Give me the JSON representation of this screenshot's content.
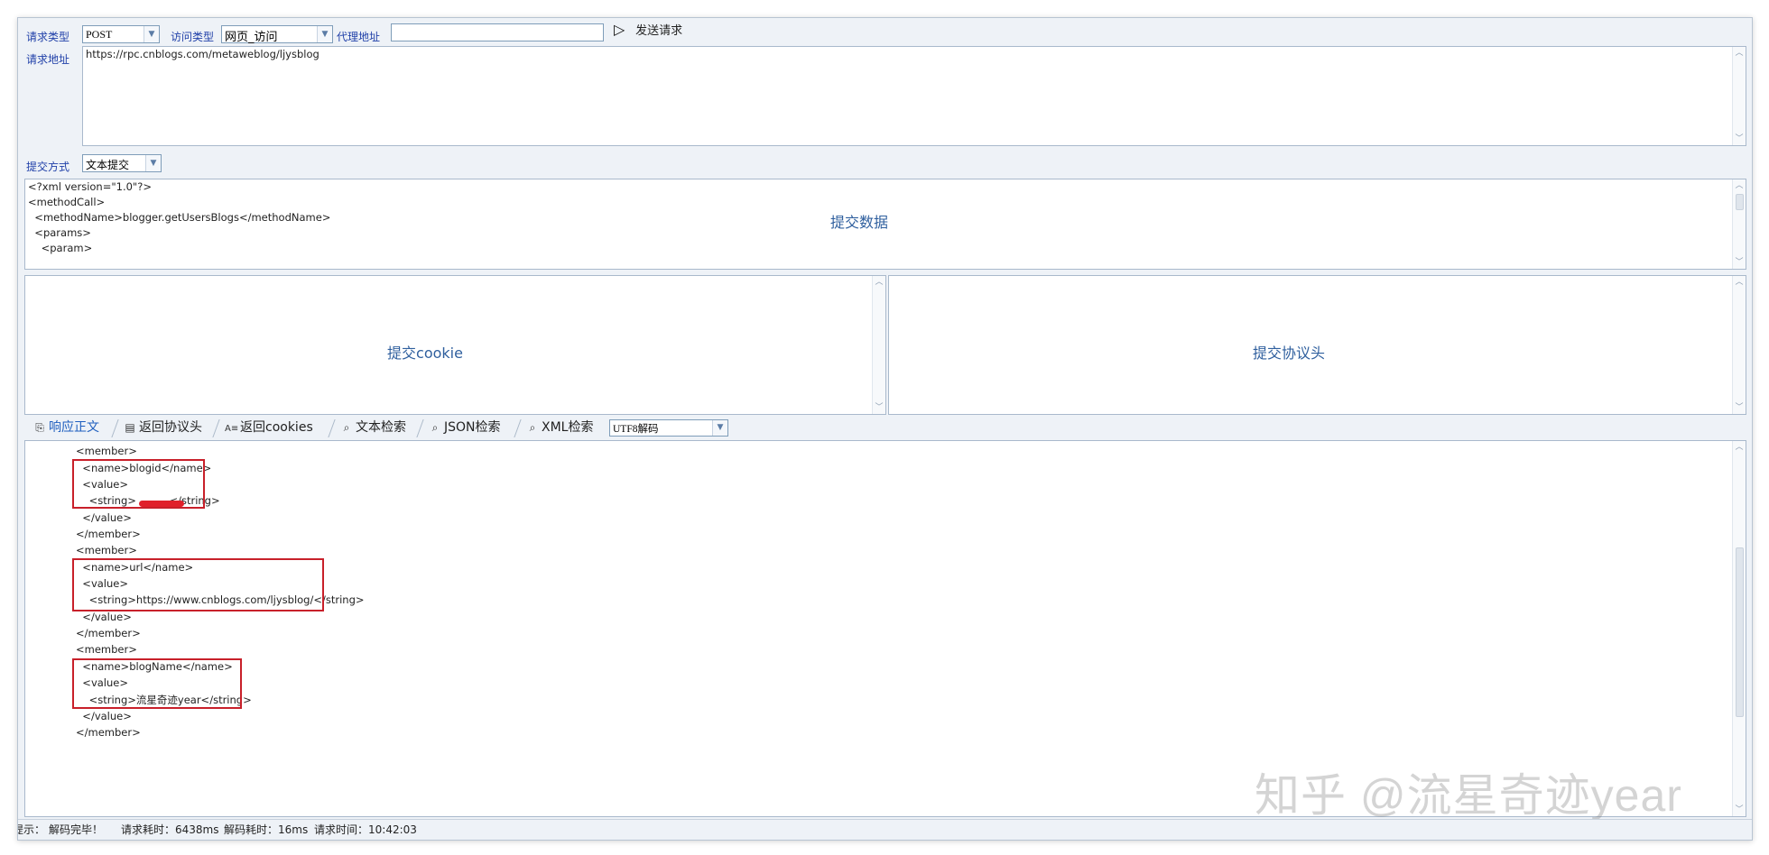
{
  "toolbar": {
    "request_type_label": "请求类型",
    "request_type_value": "POST",
    "access_type_label": "访问类型",
    "access_type_value": "网页_访问",
    "proxy_label": "代理地址",
    "proxy_value": "",
    "send_label": "发送请求"
  },
  "url_section": {
    "label": "请求地址",
    "value": "https://rpc.cnblogs.com/metaweblog/ljysblog"
  },
  "submit_section": {
    "label": "提交方式",
    "mode_value": "文本提交",
    "data_placeholder": "提交数据",
    "data_lines": [
      "<?xml version=\"1.0\"?>",
      "<methodCall>",
      "  <methodName>blogger.getUsersBlogs</methodName>",
      "  <params>",
      "    <param>"
    ],
    "cookie_placeholder": "提交cookie",
    "headers_placeholder": "提交协议头"
  },
  "response_tabs": {
    "tabs": [
      {
        "label": "响应正文",
        "icon": "response-icon"
      },
      {
        "label": "返回协议头",
        "icon": "document-icon"
      },
      {
        "label": "返回cookies",
        "icon": "cookie-text-icon"
      },
      {
        "label": "文本检索",
        "icon": "search-icon"
      },
      {
        "label": "JSON检索",
        "icon": "search-icon"
      },
      {
        "label": "XML检索",
        "icon": "search-icon"
      }
    ],
    "decode_value": "UTF8解码"
  },
  "response_body": {
    "lines": [
      "<member>",
      "  <name>blogid</name>",
      "  <value>",
      "    <string>          </string>",
      "  </value>",
      "</member>",
      "<member>",
      "  <name>url</name>",
      "  <value>",
      "    <string>https://www.cnblogs.com/ljysblog/</string>",
      "  </value>",
      "</member>",
      "<member>",
      "  <name>blogName</name>",
      "  <value>",
      "    <string>流星奇迹year</string>",
      "  </value>",
      "</member>"
    ]
  },
  "status": {
    "hint": "提示：",
    "decode_msg": "解码完毕！",
    "request_time": "请求耗时：6438ms",
    "decode_time": "解码耗时：16ms",
    "request_clock": "请求时间：10:42:03"
  },
  "watermark": "知乎 @流星奇迹year",
  "colors": {
    "accent": "#1f5fbf",
    "label": "#1f3fa8",
    "highlight_box": "#c8202a",
    "window_bg": "#eef2f7"
  }
}
